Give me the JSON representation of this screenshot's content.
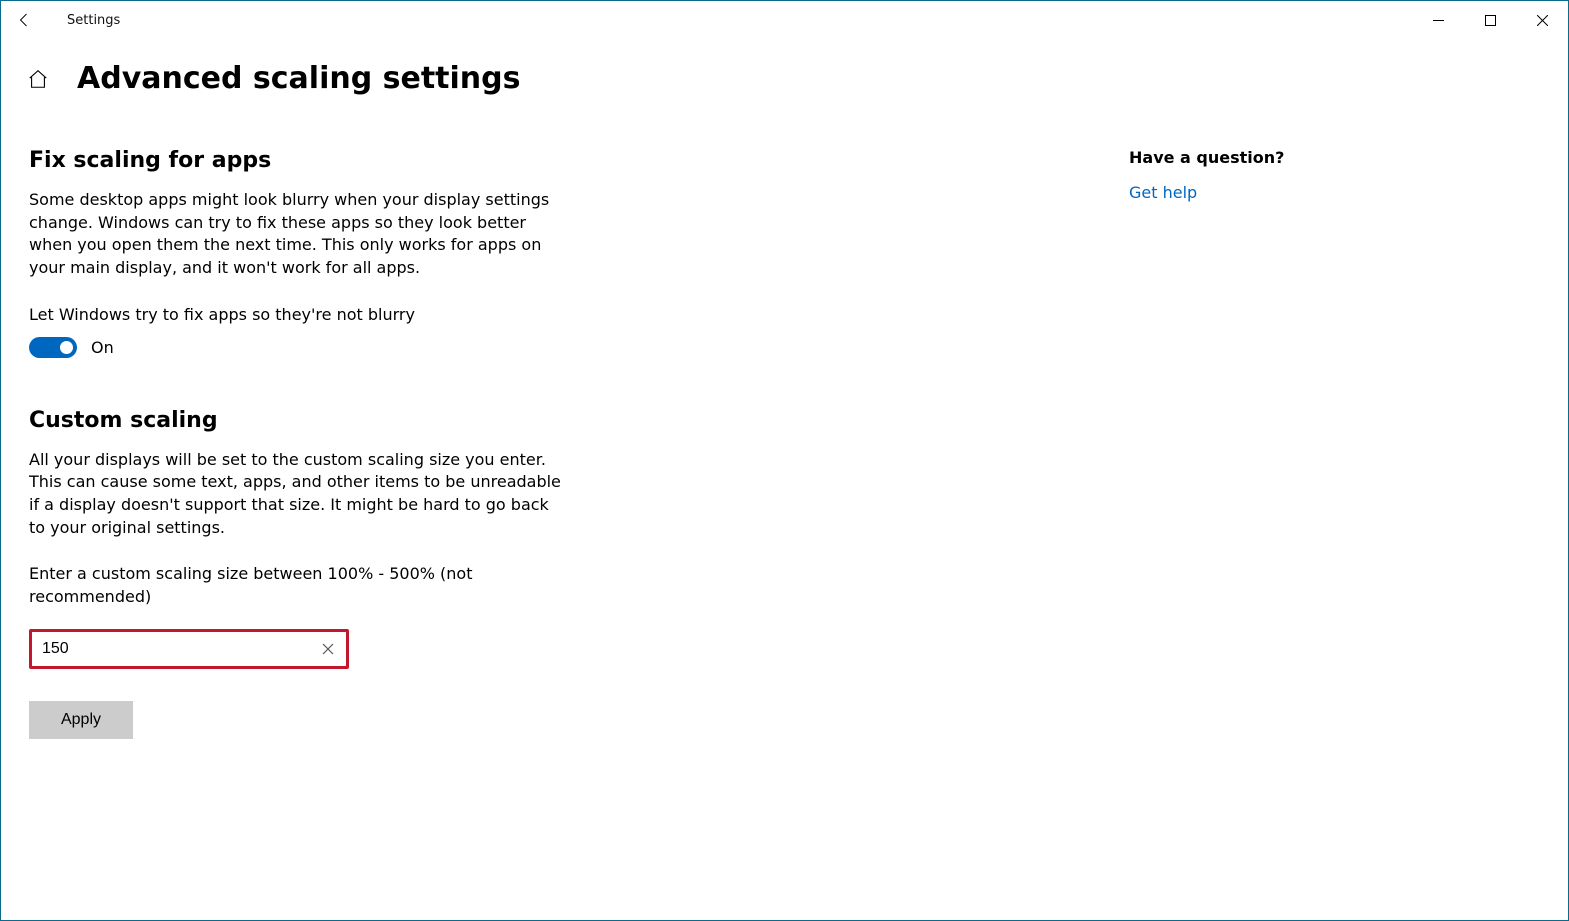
{
  "window": {
    "appTitle": "Settings"
  },
  "header": {
    "pageTitle": "Advanced scaling settings"
  },
  "sections": {
    "fixScaling": {
      "title": "Fix scaling for apps",
      "description": "Some desktop apps might look blurry when your display settings change. Windows can try to fix these apps so they look better when you open them the next time. This only works for apps on your main display, and it won't work for all apps.",
      "toggleLabel": "Let Windows try to fix apps so they're not blurry",
      "toggleState": "On"
    },
    "customScaling": {
      "title": "Custom scaling",
      "description": "All your displays will be set to the custom scaling size you enter. This can cause some text, apps, and other items to be unreadable if a display doesn't support that size. It might be hard to go back to your original settings.",
      "inputLabel": "Enter a custom scaling size between 100% - 500% (not recommended)",
      "inputValue": "150",
      "applyLabel": "Apply"
    }
  },
  "sidebar": {
    "questionHeading": "Have a question?",
    "helpLink": "Get help"
  }
}
